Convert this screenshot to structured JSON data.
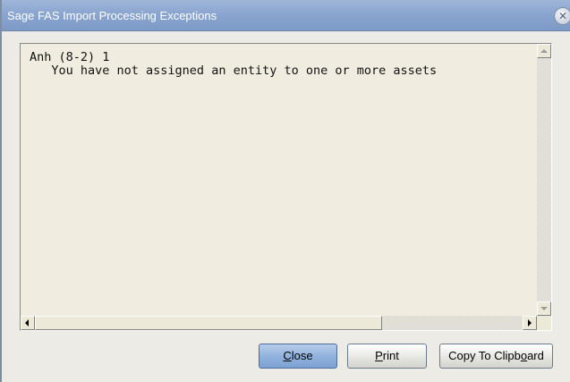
{
  "window": {
    "title": "Sage FAS Import Processing Exceptions",
    "close_glyph": "✕"
  },
  "content": {
    "lines": [
      "Anh (8-2) 1",
      "   You have not assigned an entity to one or more assets"
    ]
  },
  "buttons": {
    "close": {
      "label": "Close",
      "mnemonic": "C"
    },
    "print": {
      "label": "Print",
      "mnemonic": "P"
    },
    "copy": {
      "label": "Copy To Clipboard",
      "mnemonic": "o"
    }
  },
  "colors": {
    "titlebar": "#8aa5cf",
    "panel_background": "#f0ede0",
    "window_background": "#ecebe6",
    "primary_button": "#8fb1dc"
  },
  "icons": {
    "close": "close-x-icon",
    "scroll_up": "arrow-up-icon",
    "scroll_down": "arrow-down-icon",
    "scroll_left": "arrow-left-icon",
    "scroll_right": "arrow-right-icon"
  }
}
